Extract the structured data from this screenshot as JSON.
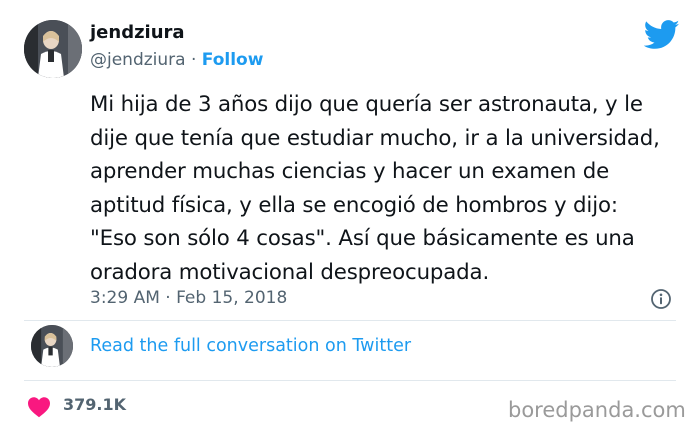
{
  "tweet": {
    "display_name": "jendziura",
    "handle": "@jendziura",
    "separator": "·",
    "follow_label": "Follow",
    "text_lines": [
      "Mi hija de 3 años dijo que quería ser astronauta, y le",
      "dije que tenía que estudiar mucho, ir a la universidad,",
      "aprender muchas ciencias y hacer un examen de",
      "aptitud física, y ella se encogió de hombros y dijo:",
      "\"Eso son sólo 4 cosas\". Así que básicamente es una",
      "oradora motivacional despreocupada."
    ],
    "timestamp": "3:29 AM · Feb 15, 2018",
    "read_full_label": "Read the full conversation on Twitter",
    "likes": "379.1K"
  },
  "watermark": "boredpanda.com",
  "colors": {
    "accent": "#1d9bf0",
    "text": "#0f1419",
    "secondary": "#536471",
    "heart": "#f91880"
  },
  "icons": {
    "brand": "twitter-bird-icon",
    "info": "info-icon",
    "like": "heart-icon"
  }
}
